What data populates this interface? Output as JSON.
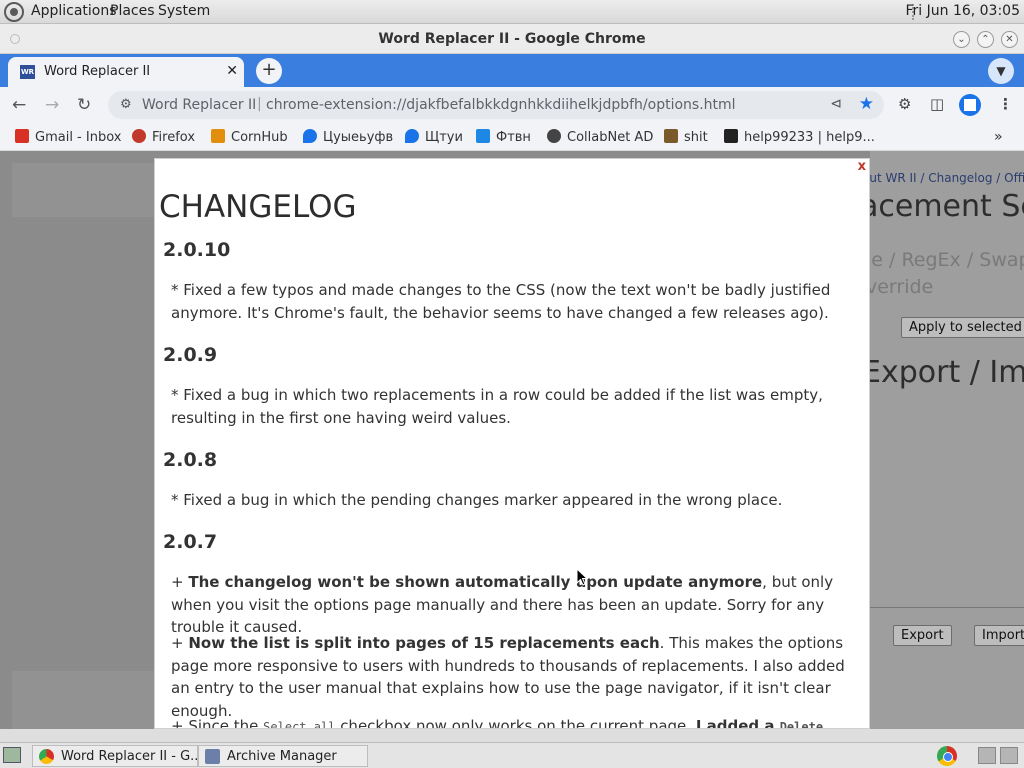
{
  "system_bar": {
    "menus": [
      "Applications",
      "Places",
      "System"
    ],
    "clock": "Fri Jun 16, 03:05"
  },
  "window": {
    "title": "Word Replacer II - Google Chrome"
  },
  "tabs": [
    {
      "label": "Word Replacer II",
      "favicon": "WR"
    }
  ],
  "omnibox": {
    "site_name": "Word Replacer II",
    "url": "chrome-extension://djakfbefalbkkdgnhkkdiihelkjdpbfh/options.html"
  },
  "bookmarks": [
    {
      "label": "Gmail - Inbox",
      "icon": "gmail-icon",
      "color": "#d93025"
    },
    {
      "label": "Firefox",
      "icon": "firefox-icon",
      "color": "#c0392b"
    },
    {
      "label": "CornHub",
      "icon": "ch-icon",
      "color": "#e08e0b"
    },
    {
      "label": "Цуыеьуфв",
      "icon": "maps-icon",
      "color": "#1a73e8"
    },
    {
      "label": "Щтуи",
      "icon": "maps-icon",
      "color": "#1a73e8"
    },
    {
      "label": "Фтвн",
      "icon": "bird-icon",
      "color": "#1e88e5"
    },
    {
      "label": "CollabNet AD",
      "icon": "globe-icon",
      "color": "#444444"
    },
    {
      "label": "shit",
      "icon": "hp-icon",
      "color": "#7a5a2a"
    },
    {
      "label": "help99233 | help9...",
      "icon": "wix-icon",
      "color": "#222222"
    }
  ],
  "background_page": {
    "links": "out WR II / Changelog / Offici",
    "heading": "acement Se",
    "types_line1": "le / RegEx / Swap",
    "types_line2": "verride",
    "apply_button": "Apply to selected",
    "export_heading": "Export / Imp",
    "export_button": "Export",
    "import_button": "Import"
  },
  "changelog": {
    "title": "CHANGELOG",
    "close": "x",
    "v2010": {
      "version": "2.0.10",
      "text": "* Fixed a few typos and made changes to the CSS (now the text won't be badly justified anymore. It's Chrome's fault, the behavior seems to have changed a few releases ago)."
    },
    "v209": {
      "version": "2.0.9",
      "text": "* Fixed a bug in which two replacements in a row could be added if the list was empty, resulting in the first one having weird values."
    },
    "v208": {
      "version": "2.0.8",
      "text": "* Fixed a bug in which the pending changes marker appeared in the wrong place."
    },
    "v207": {
      "version": "2.0.7",
      "p1_prefix": "+ ",
      "p1_bold": "The changelog won't be shown automatically upon update anymore",
      "p1_rest": ", but only when you visit the options page manually and there has been an update. Sorry for any trouble it caused.",
      "p2_prefix": "+ ",
      "p2_bold": "Now the list is split into pages of 15 replacements each",
      "p2_rest": ". This makes the options page more responsive to users with hundreds to thousands of replacements. I also added an entry to the user manual that explains how to use the page navigator, if it isn't clear enough.",
      "p3_prefix": "+ Since the ",
      "p3_code": "Select all",
      "p3_mid": " checkbox now only works on the current page, ",
      "p3_bold": "I added a ",
      "p3_code2": "Delete"
    }
  },
  "taskbar": {
    "tasks": [
      "Word Replacer II - G...",
      "Archive Manager"
    ]
  }
}
